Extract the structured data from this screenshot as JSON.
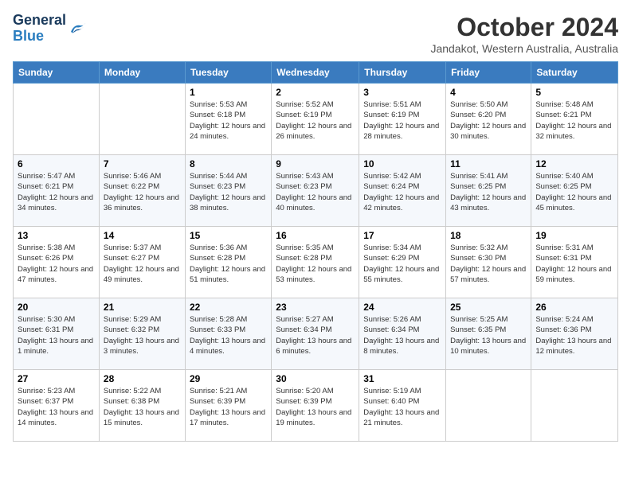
{
  "header": {
    "logo_general": "General",
    "logo_blue": "Blue",
    "month_title": "October 2024",
    "location": "Jandakot, Western Australia, Australia"
  },
  "days_of_week": [
    "Sunday",
    "Monday",
    "Tuesday",
    "Wednesday",
    "Thursday",
    "Friday",
    "Saturday"
  ],
  "weeks": [
    [
      {
        "day": "",
        "info": ""
      },
      {
        "day": "",
        "info": ""
      },
      {
        "day": "1",
        "info": "Sunrise: 5:53 AM\nSunset: 6:18 PM\nDaylight: 12 hours and 24 minutes."
      },
      {
        "day": "2",
        "info": "Sunrise: 5:52 AM\nSunset: 6:19 PM\nDaylight: 12 hours and 26 minutes."
      },
      {
        "day": "3",
        "info": "Sunrise: 5:51 AM\nSunset: 6:19 PM\nDaylight: 12 hours and 28 minutes."
      },
      {
        "day": "4",
        "info": "Sunrise: 5:50 AM\nSunset: 6:20 PM\nDaylight: 12 hours and 30 minutes."
      },
      {
        "day": "5",
        "info": "Sunrise: 5:48 AM\nSunset: 6:21 PM\nDaylight: 12 hours and 32 minutes."
      }
    ],
    [
      {
        "day": "6",
        "info": "Sunrise: 5:47 AM\nSunset: 6:21 PM\nDaylight: 12 hours and 34 minutes."
      },
      {
        "day": "7",
        "info": "Sunrise: 5:46 AM\nSunset: 6:22 PM\nDaylight: 12 hours and 36 minutes."
      },
      {
        "day": "8",
        "info": "Sunrise: 5:44 AM\nSunset: 6:23 PM\nDaylight: 12 hours and 38 minutes."
      },
      {
        "day": "9",
        "info": "Sunrise: 5:43 AM\nSunset: 6:23 PM\nDaylight: 12 hours and 40 minutes."
      },
      {
        "day": "10",
        "info": "Sunrise: 5:42 AM\nSunset: 6:24 PM\nDaylight: 12 hours and 42 minutes."
      },
      {
        "day": "11",
        "info": "Sunrise: 5:41 AM\nSunset: 6:25 PM\nDaylight: 12 hours and 43 minutes."
      },
      {
        "day": "12",
        "info": "Sunrise: 5:40 AM\nSunset: 6:25 PM\nDaylight: 12 hours and 45 minutes."
      }
    ],
    [
      {
        "day": "13",
        "info": "Sunrise: 5:38 AM\nSunset: 6:26 PM\nDaylight: 12 hours and 47 minutes."
      },
      {
        "day": "14",
        "info": "Sunrise: 5:37 AM\nSunset: 6:27 PM\nDaylight: 12 hours and 49 minutes."
      },
      {
        "day": "15",
        "info": "Sunrise: 5:36 AM\nSunset: 6:28 PM\nDaylight: 12 hours and 51 minutes."
      },
      {
        "day": "16",
        "info": "Sunrise: 5:35 AM\nSunset: 6:28 PM\nDaylight: 12 hours and 53 minutes."
      },
      {
        "day": "17",
        "info": "Sunrise: 5:34 AM\nSunset: 6:29 PM\nDaylight: 12 hours and 55 minutes."
      },
      {
        "day": "18",
        "info": "Sunrise: 5:32 AM\nSunset: 6:30 PM\nDaylight: 12 hours and 57 minutes."
      },
      {
        "day": "19",
        "info": "Sunrise: 5:31 AM\nSunset: 6:31 PM\nDaylight: 12 hours and 59 minutes."
      }
    ],
    [
      {
        "day": "20",
        "info": "Sunrise: 5:30 AM\nSunset: 6:31 PM\nDaylight: 13 hours and 1 minute."
      },
      {
        "day": "21",
        "info": "Sunrise: 5:29 AM\nSunset: 6:32 PM\nDaylight: 13 hours and 3 minutes."
      },
      {
        "day": "22",
        "info": "Sunrise: 5:28 AM\nSunset: 6:33 PM\nDaylight: 13 hours and 4 minutes."
      },
      {
        "day": "23",
        "info": "Sunrise: 5:27 AM\nSunset: 6:34 PM\nDaylight: 13 hours and 6 minutes."
      },
      {
        "day": "24",
        "info": "Sunrise: 5:26 AM\nSunset: 6:34 PM\nDaylight: 13 hours and 8 minutes."
      },
      {
        "day": "25",
        "info": "Sunrise: 5:25 AM\nSunset: 6:35 PM\nDaylight: 13 hours and 10 minutes."
      },
      {
        "day": "26",
        "info": "Sunrise: 5:24 AM\nSunset: 6:36 PM\nDaylight: 13 hours and 12 minutes."
      }
    ],
    [
      {
        "day": "27",
        "info": "Sunrise: 5:23 AM\nSunset: 6:37 PM\nDaylight: 13 hours and 14 minutes."
      },
      {
        "day": "28",
        "info": "Sunrise: 5:22 AM\nSunset: 6:38 PM\nDaylight: 13 hours and 15 minutes."
      },
      {
        "day": "29",
        "info": "Sunrise: 5:21 AM\nSunset: 6:39 PM\nDaylight: 13 hours and 17 minutes."
      },
      {
        "day": "30",
        "info": "Sunrise: 5:20 AM\nSunset: 6:39 PM\nDaylight: 13 hours and 19 minutes."
      },
      {
        "day": "31",
        "info": "Sunrise: 5:19 AM\nSunset: 6:40 PM\nDaylight: 13 hours and 21 minutes."
      },
      {
        "day": "",
        "info": ""
      },
      {
        "day": "",
        "info": ""
      }
    ]
  ]
}
